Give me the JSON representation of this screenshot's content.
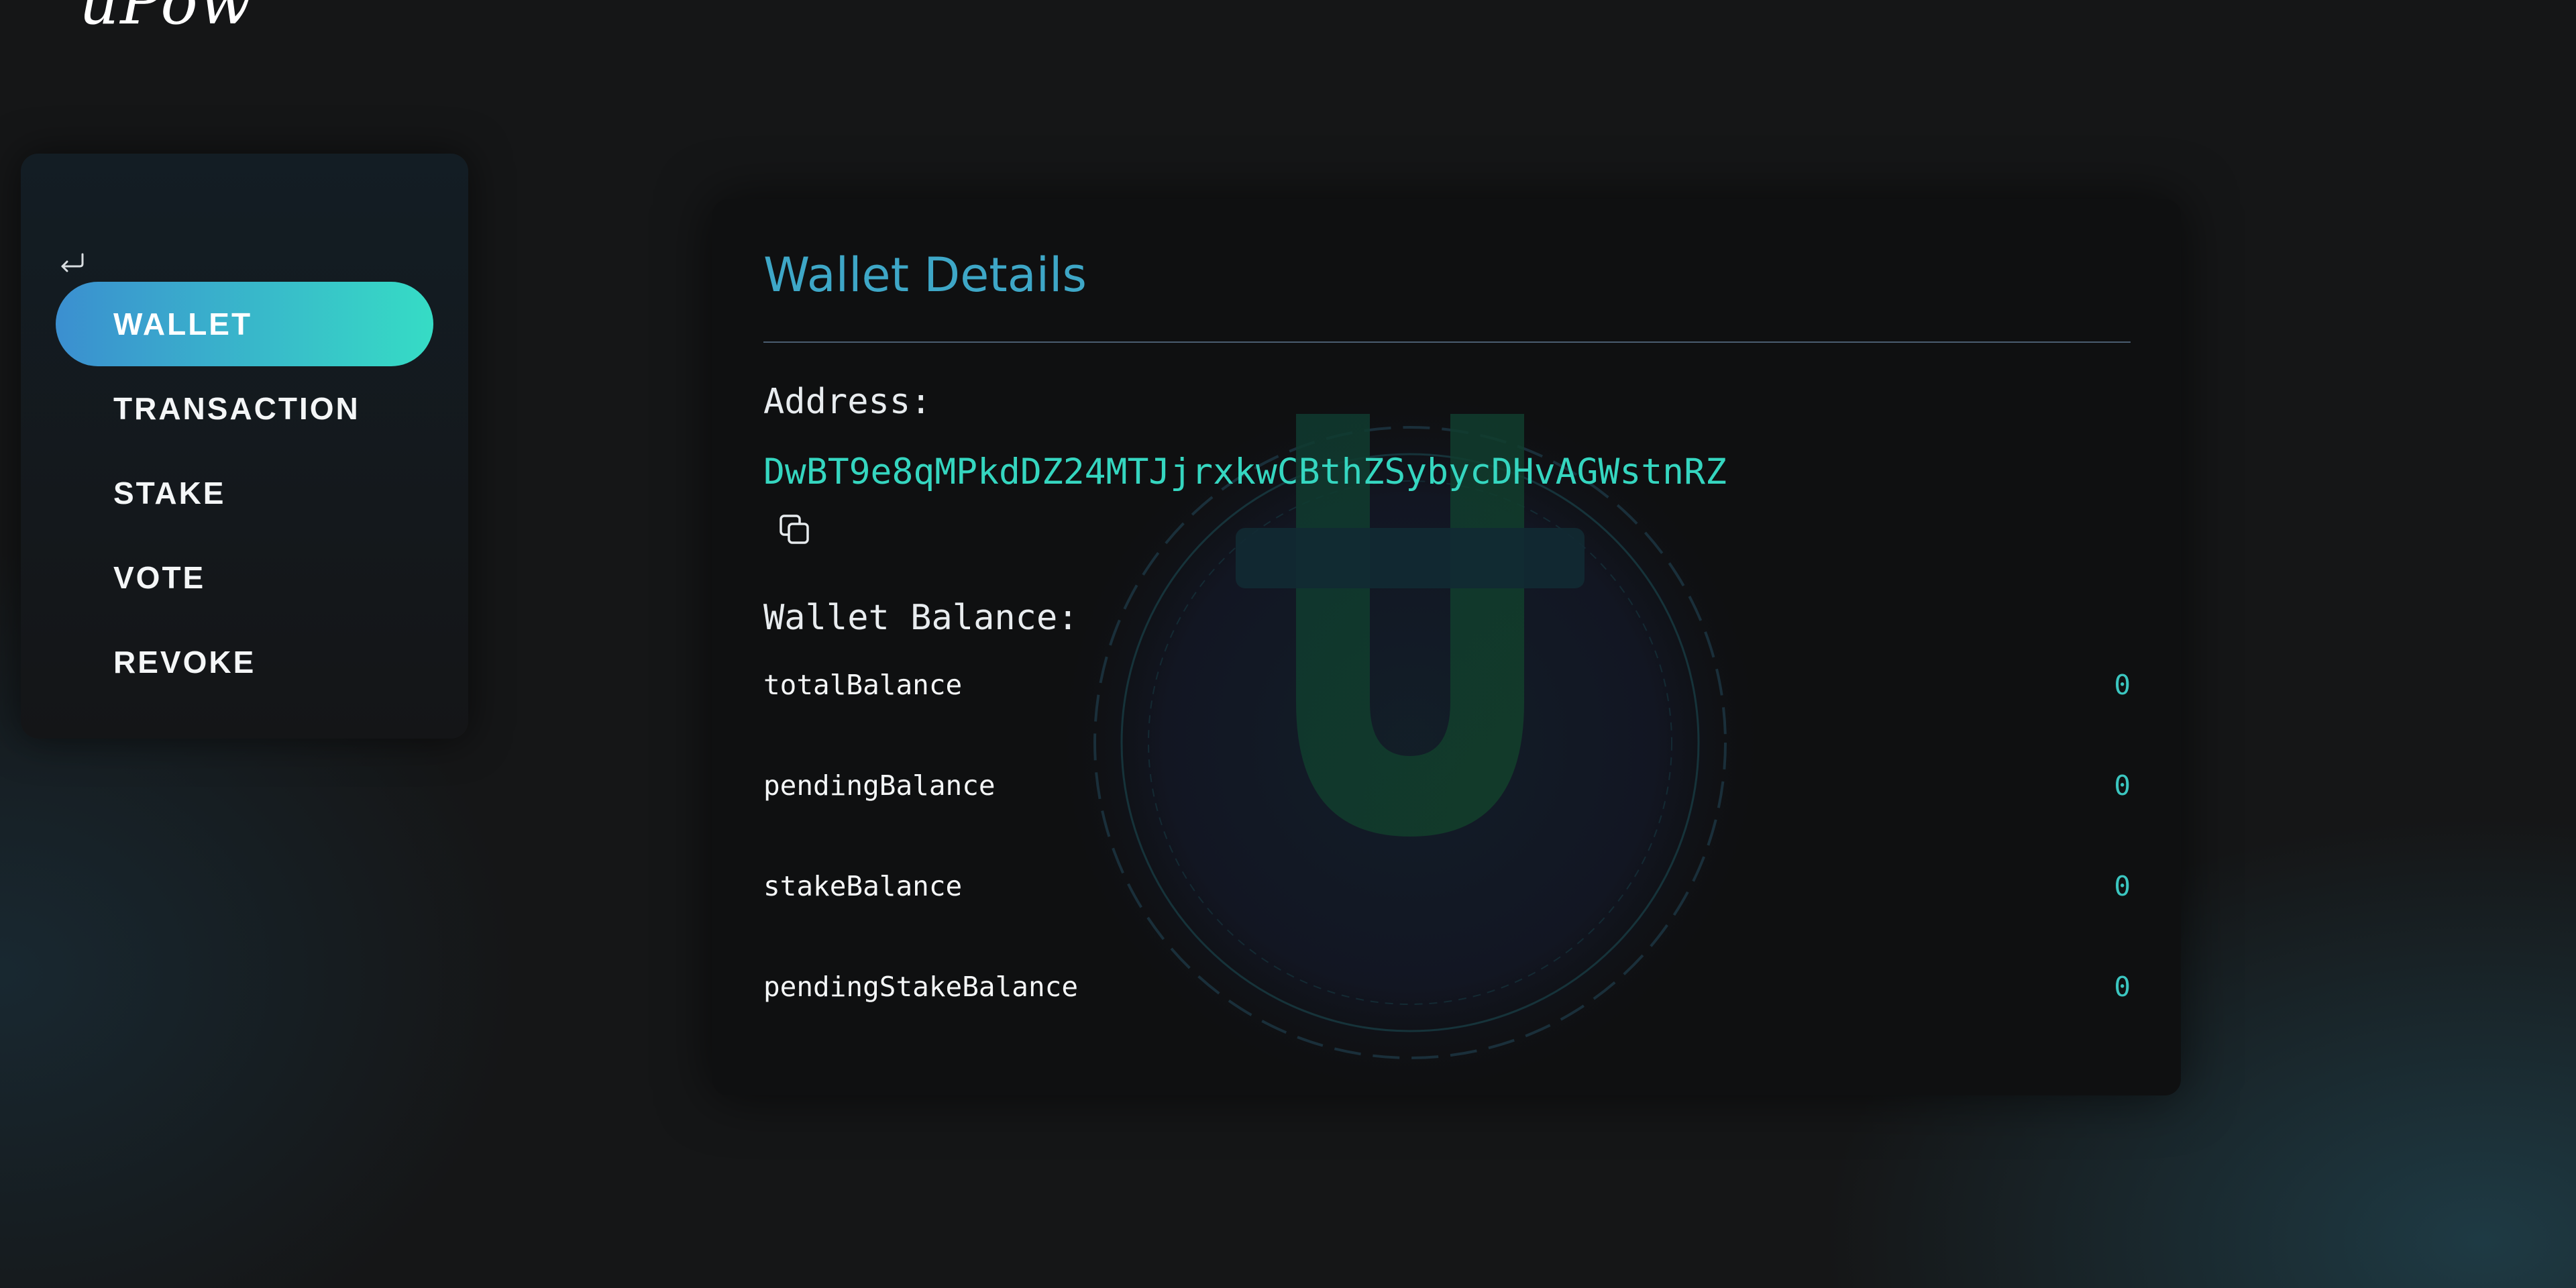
{
  "app": {
    "logo_text": "uPow"
  },
  "colors": {
    "accent_start": "#3b8fd0",
    "accent_end": "#36dcc5",
    "title": "#3ea7c7",
    "address": "#35d6c0",
    "background": "#151617"
  },
  "sidebar": {
    "back_icon": "return-arrow-icon",
    "items": [
      {
        "label": "WALLET",
        "active": true
      },
      {
        "label": "TRANSACTION",
        "active": false
      },
      {
        "label": "STAKE",
        "active": false
      },
      {
        "label": "VOTE",
        "active": false
      },
      {
        "label": "REVOKE",
        "active": false
      }
    ]
  },
  "wallet": {
    "title": "Wallet Details",
    "address_label": "Address:",
    "address": "DwBT9e8qMPkdDZ24MTJjrxkwCBthZSybycDHvAGWstnRZ",
    "copy_icon": "copy-icon",
    "balance_label": "Wallet Balance:",
    "balances": [
      {
        "key": "totalBalance",
        "value": "0"
      },
      {
        "key": "pendingBalance",
        "value": "0"
      },
      {
        "key": "stakeBalance",
        "value": "0"
      },
      {
        "key": "pendingStakeBalance",
        "value": "0"
      }
    ]
  }
}
